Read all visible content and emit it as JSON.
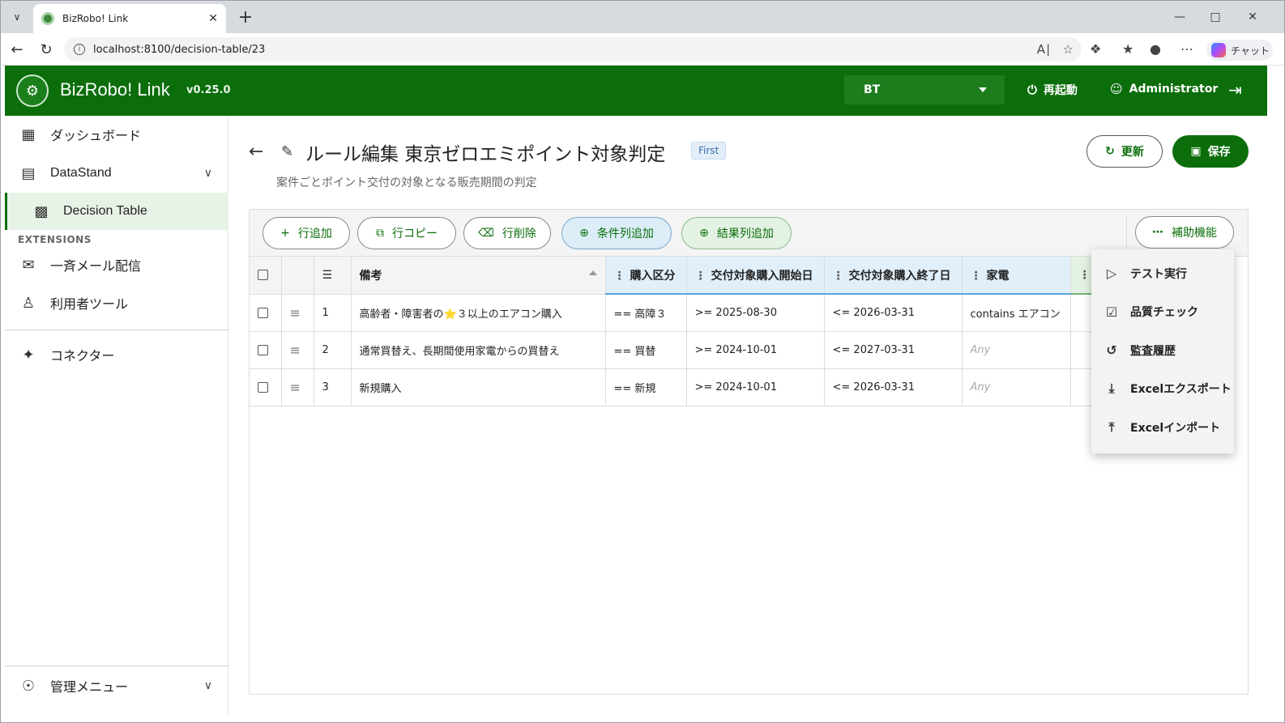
{
  "browser": {
    "tab_title": "BizRobo! Link",
    "url": "localhost:8100/decision-table/23",
    "copilot_label": "チャット"
  },
  "header": {
    "app_name": "BizRobo! Link",
    "version": "v0.25.0",
    "environment": "BT",
    "restart_label": "再起動",
    "user_label": "Administrator"
  },
  "sidebar": {
    "dashboard": "ダッシュボード",
    "datastand": "DataStand",
    "decision_table": "Decision Table",
    "extensions_label": "EXTENSIONS",
    "bulk_mail": "一斉メール配信",
    "user_tools": "利用者ツール",
    "connector": "コネクター",
    "admin_menu": "管理メニュー"
  },
  "page": {
    "title": "ルール編集 東京ゼロエミポイント対象判定",
    "badge": "First",
    "subtitle": "案件ごとポイント交付の対象となる販売期間の判定",
    "refresh_label": "更新",
    "save_label": "保存"
  },
  "toolbar": {
    "add_row": "行追加",
    "copy_row": "行コピー",
    "delete_row": "行削除",
    "add_condition_col": "条件列追加",
    "add_result_col": "結果列追加",
    "assist": "補助機能"
  },
  "table": {
    "headers": {
      "memo": "備考",
      "purchase_type": "購入区分",
      "start_date": "交付対象購入開始日",
      "end_date": "交付対象購入終了日",
      "appliance": "家電"
    },
    "rows": [
      {
        "num": "1",
        "memo_a": "高齢者・障害者の",
        "memo_b": "３以上のエアコン購入",
        "purchase_type": "== 高障３",
        "start_date": ">= 2025-08-30",
        "end_date": "<= 2026-03-31",
        "appliance": "contains エアコン"
      },
      {
        "num": "2",
        "memo": "通常買替え、長期間使用家電からの買替え",
        "purchase_type": "== 買替",
        "start_date": ">= 2024-10-01",
        "end_date": "<= 2027-03-31",
        "appliance": "Any"
      },
      {
        "num": "3",
        "memo": "新規購入",
        "purchase_type": "== 新規",
        "start_date": ">= 2024-10-01",
        "end_date": "<= 2026-03-31",
        "appliance": "Any"
      }
    ]
  },
  "menu": {
    "test_run": "テスト実行",
    "quality_check": "品質チェック",
    "audit_history": "監査履歴",
    "excel_export": "Excelエクスポート",
    "excel_import": "Excelインポート"
  },
  "colors": {
    "brand_green": "#0b6e0b",
    "condition_blue": "#e1effa",
    "result_green": "#e4f2e4"
  }
}
